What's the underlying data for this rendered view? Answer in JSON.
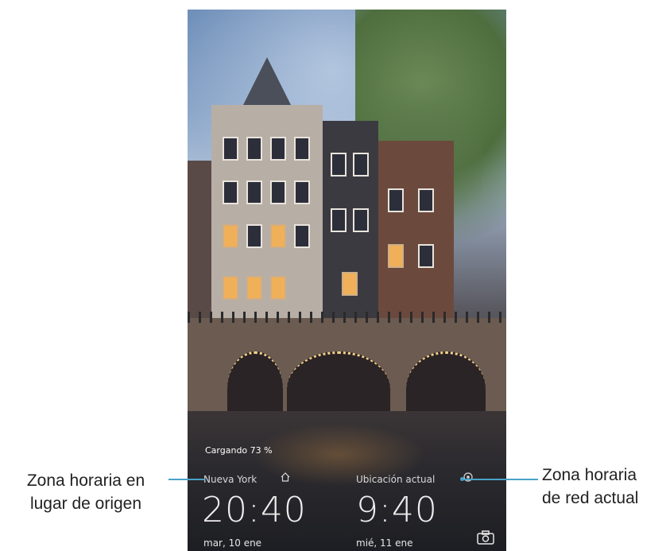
{
  "lockscreen": {
    "charging_status": "Cargando 73 %",
    "home_clock": {
      "city": "Nueva York",
      "time": "20:40",
      "date": "mar, 10 ene"
    },
    "current_clock": {
      "city": "Ubicación actual",
      "time": "9:40",
      "date": "mié, 11 ene"
    },
    "icons": {
      "home": "home-icon",
      "location": "location-icon",
      "camera": "camera-icon"
    }
  },
  "annotations": {
    "left": [
      "Zona horaria en",
      "lugar de origen"
    ],
    "right": [
      "Zona horaria",
      "de red actual"
    ]
  },
  "colors": {
    "annotation_line": "#4aa2c8",
    "clock_text": "#ffffff"
  }
}
